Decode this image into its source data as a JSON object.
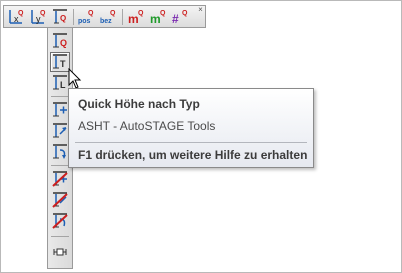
{
  "toolbar_horizontal": {
    "buttons": [
      {
        "name": "quick-x-button",
        "glyph": "x",
        "sup": "Q"
      },
      {
        "name": "quick-y-button",
        "glyph": "y",
        "sup": "Q"
      },
      {
        "name": "quick-height-button",
        "glyph": "",
        "sup": "Q"
      },
      {
        "name": "quick-pos-button",
        "glyph": "pos",
        "sup": "Q"
      },
      {
        "name": "quick-bez-button",
        "glyph": "bez",
        "sup": "Q"
      },
      {
        "name": "quick-m-red-button",
        "glyph": "m",
        "sup": "Q"
      },
      {
        "name": "quick-m-green-button",
        "glyph": "m",
        "sup": "Q"
      },
      {
        "name": "quick-number-button",
        "glyph": "#",
        "sup": "Q"
      }
    ],
    "close_glyph": "×"
  },
  "toolbar_vertical": {
    "buttons": [
      {
        "name": "height-q-button",
        "letter": "Q"
      },
      {
        "name": "height-t-button",
        "letter": "T",
        "hover": true
      },
      {
        "name": "height-l-button",
        "letter": "L"
      },
      {
        "name": "height-plus-button"
      },
      {
        "name": "height-arrow-button"
      },
      {
        "name": "height-curve-button"
      },
      {
        "name": "height-delete-plus-button"
      },
      {
        "name": "height-delete-arrow-button"
      },
      {
        "name": "height-delete-curve-button"
      },
      {
        "name": "toolbar-handle-button"
      }
    ]
  },
  "tooltip": {
    "title": "Quick Höhe nach Typ",
    "subtitle": "ASHT - AutoSTAGE Tools",
    "help": "F1 drücken, um weitere Hilfe zu erhalten"
  },
  "colors": {
    "icon_blue": "#1d5fb4",
    "icon_red": "#cc1f1f",
    "icon_green": "#1f9a2a",
    "icon_purple": "#7a2ab0"
  }
}
